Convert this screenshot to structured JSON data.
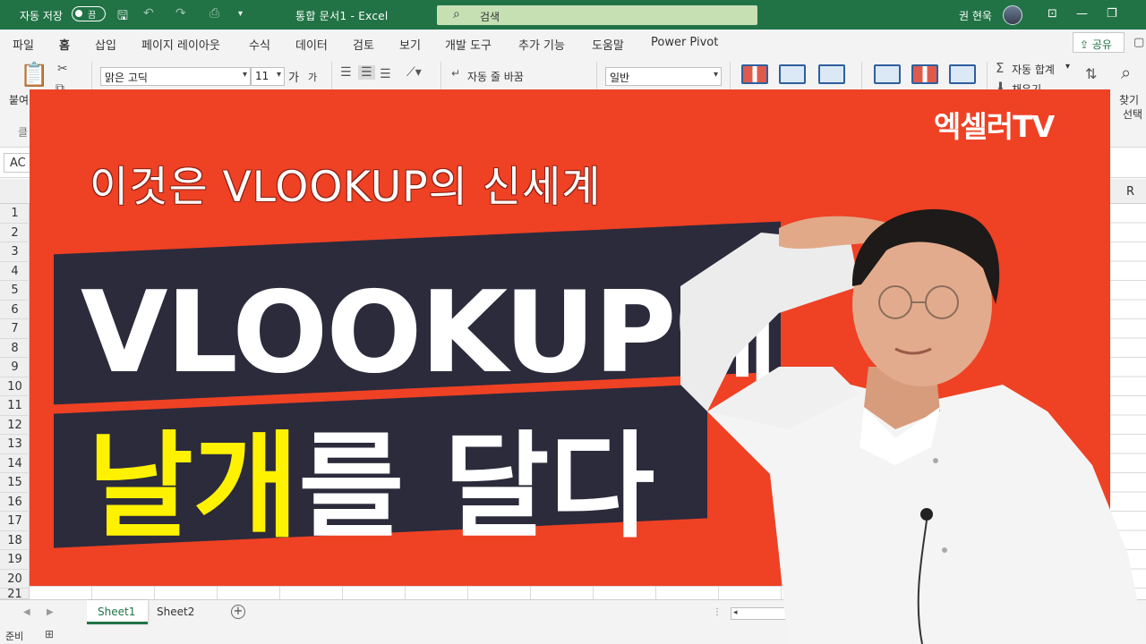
{
  "titlebar": {
    "autosave_label": "자동 저장",
    "autosave_state": "끔",
    "document_title": "통합 문서1  -  Excel",
    "search_placeholder": "검색",
    "user_name": "권 현욱"
  },
  "ribbon": {
    "tabs": [
      "파일",
      "홈",
      "삽입",
      "페이지 레이아웃",
      "수식",
      "데이터",
      "검토",
      "보기",
      "개발 도구",
      "추가 기능",
      "도움말",
      "Power Pivot"
    ],
    "active_tab": "홈",
    "share_label": "공유",
    "paste_label": "붙여",
    "clipboard_label": "클",
    "font_name": "맑은 고딕",
    "font_size": "11",
    "font_grow": "가",
    "font_shrink": "가",
    "wrap_text_label": "자동 줄 바꿈",
    "number_format": "일반",
    "autosum_label": "자동 합계",
    "fill_label": "채우기",
    "find_label": "찾기",
    "select_label": "선택"
  },
  "formula": {
    "name_box": "AC"
  },
  "grid": {
    "column_visible": "R",
    "rows": [
      "1",
      "2",
      "3",
      "4",
      "5",
      "6",
      "7",
      "8",
      "9",
      "10",
      "11",
      "12",
      "13",
      "14",
      "15",
      "16",
      "17",
      "18",
      "19",
      "20",
      "21"
    ]
  },
  "sheets": {
    "tabs": [
      "Sheet1",
      "Sheet2"
    ],
    "active": "Sheet1"
  },
  "statusbar": {
    "status": "준비"
  },
  "overlay": {
    "brand": "엑셀러TV",
    "subtitle": "이것은 VLOOKUP의 신세계",
    "headline_line1": "VLOOKUP에",
    "headline_line2_highlight": "날개",
    "headline_line2_rest": "를 달다",
    "colors": {
      "background": "#ef4124",
      "box": "#2b2b3c",
      "highlight": "#fff200",
      "excel_green": "#217346"
    }
  }
}
